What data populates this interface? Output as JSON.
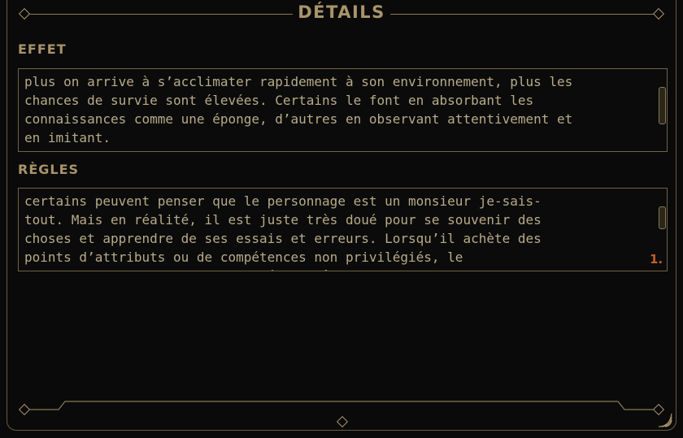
{
  "panel": {
    "title": "DÉTAILS",
    "effect_label": "EFFET",
    "effect_text": "plus on arrive à s’acclimater rapidement à son environnement, plus les\nchances de survie sont élevées. Certains le font en absorbant les\nconnaissances comme une éponge, d’autres en observant attentivement et\nen imitant.",
    "rules_label": "RÈGLES",
    "rules_text": "certains peuvent penser que le personnage est un monsieur je-sais-\ntout. Mais en réalité, il est juste très doué pour se souvenir des\nchoses et apprendre de ses essais et erreurs. Lorsqu’il achète des\npoints d’attributs ou de compétences non privilégiés, le\npersonnage ne paie que la moitié du coût normal en points de",
    "rules_marker": "1."
  },
  "colors": {
    "accent": "#a8946a",
    "border": "#6f6346",
    "marker": "#c0602a",
    "background": "#0a0a0a"
  }
}
